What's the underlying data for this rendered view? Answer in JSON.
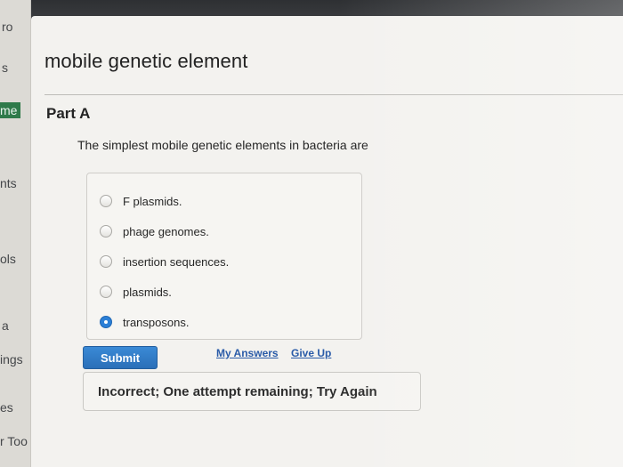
{
  "sidebar": {
    "fragments": [
      {
        "text": "ro"
      },
      {
        "text": "s"
      },
      {
        "text": "me"
      },
      {
        "text": "nts"
      },
      {
        "text": "ols"
      },
      {
        "text": "a"
      },
      {
        "text": "ings"
      },
      {
        "text": "es"
      },
      {
        "text": "r Too"
      }
    ]
  },
  "page": {
    "title": "mobile genetic element"
  },
  "part": {
    "title": "Part A",
    "question": "The simplest mobile genetic elements in bacteria are",
    "options": [
      {
        "label": "F plasmids.",
        "selected": false
      },
      {
        "label": "phage genomes.",
        "selected": false
      },
      {
        "label": "insertion sequences.",
        "selected": false
      },
      {
        "label": "plasmids.",
        "selected": false
      },
      {
        "label": "transposons.",
        "selected": true
      }
    ]
  },
  "actions": {
    "submit_label": "Submit",
    "my_answers_label": "My Answers",
    "give_up_label": "Give Up"
  },
  "feedback": {
    "text": "Incorrect; One attempt remaining; Try Again"
  },
  "colors": {
    "accent": "#2b7fd6",
    "sidebar_active": "#2f7a4a"
  }
}
